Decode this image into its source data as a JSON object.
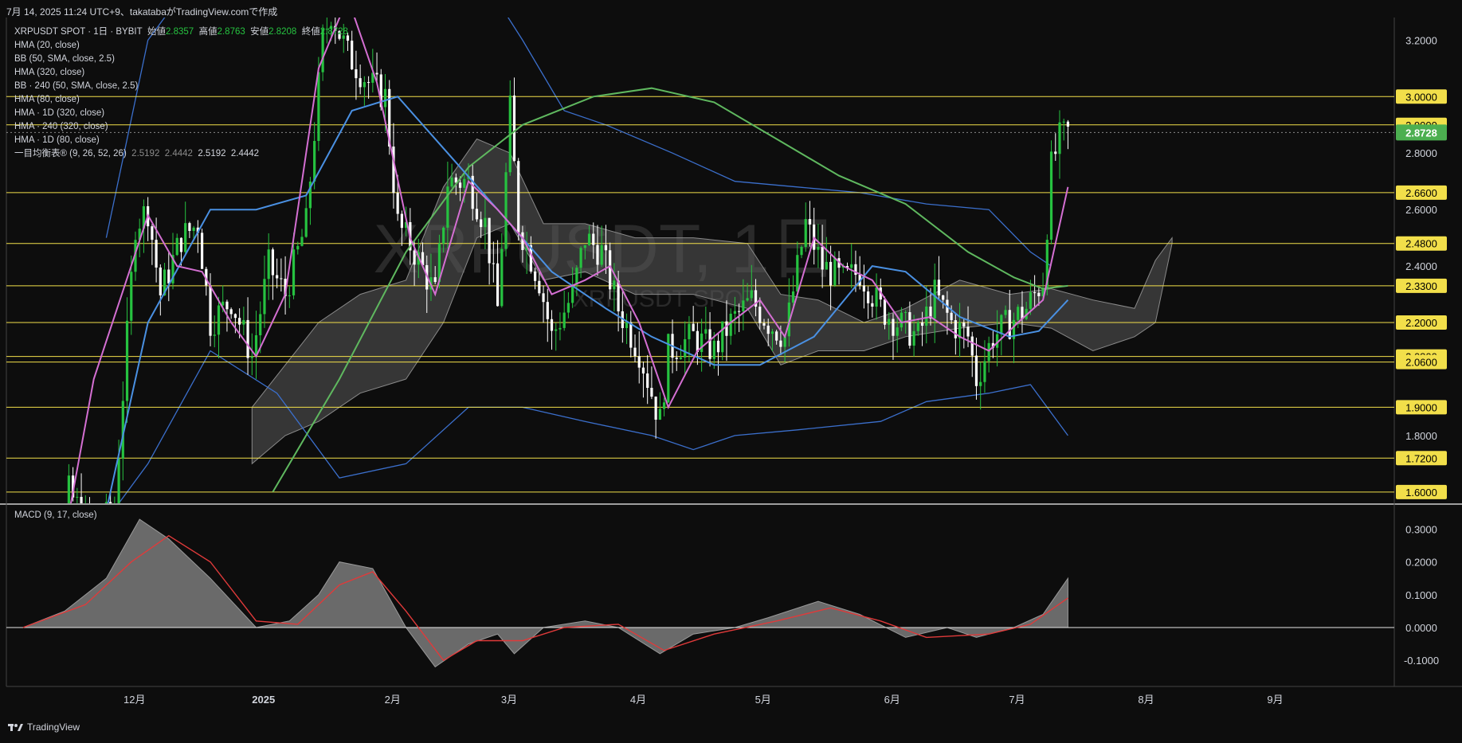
{
  "header": {
    "snapshot_line": "7月 14, 2025 11:24 UTC+9、takatabaがTradingView.comで作成"
  },
  "legend": {
    "symbol": "XRPUSDT SPOT · 1日 · BYBIT",
    "open_label": "始値",
    "open": "2.8357",
    "high_label": "高値",
    "high": "2.8763",
    "low_label": "安値",
    "low": "2.8208",
    "close_label": "終値",
    "close": "2.8728",
    "indicators": [
      "HMA (20, close)",
      "BB (50, SMA, close, 2.5)",
      "HMA (320, close)",
      "BB · 240 (50, SMA, close, 2.5)",
      "HMA (80, close)",
      "HMA · 1D (320, close)",
      "HMA · 240 (320, close)",
      "HMA · 1D (80, close)"
    ],
    "ichimoku": "一目均衡表® (9, 26, 52, 26)",
    "ichimoku_values": [
      "2.5192",
      "2.4442",
      "2.5192",
      "2.4442"
    ]
  },
  "watermark": {
    "main": "XRPUSDT, 1日",
    "sub": "XRPUSDT SPOT"
  },
  "macd_title": "MACD (9, 17, close)",
  "footer": {
    "brand": "TradingView"
  },
  "colors": {
    "background": "#0d0d0d",
    "up": "#26c240",
    "down": "#ffffff",
    "hma20": "#d46fd2",
    "hma80": "#4a90e2",
    "hma320": "#5fb85f",
    "bb": "#3b6fcc",
    "cloud": "#5a5a5a",
    "level": "#f2df4a",
    "last_price": "#4caf50",
    "macd_signal": "#e03a3a"
  },
  "chart_data": [
    {
      "type": "candlestick",
      "title": "XRPUSDT, 1日",
      "x_axis_labels": [
        "12月",
        "2025",
        "2月",
        "3月",
        "4月",
        "5月",
        "6月",
        "7月",
        "8月",
        "9月"
      ],
      "y_axis_ticks": [
        "3.2000",
        "2.8000",
        "2.6000",
        "2.4000",
        "1.8000"
      ],
      "ylim": [
        1.56,
        3.28
      ],
      "date_range": [
        "2024-11-01",
        "2025-09-30"
      ],
      "last_price": "2.8728",
      "horizontal_levels": [
        "3.0000",
        "2.9000",
        "2.6600",
        "2.4800",
        "2.3300",
        "2.2000",
        "2.0800",
        "2.0600",
        "1.9000",
        "1.7200",
        "1.6000"
      ],
      "close_path": [
        [
          "2024-11-05",
          0.55
        ],
        [
          "2024-11-12",
          1.1
        ],
        [
          "2024-11-16",
          1.6
        ],
        [
          "2024-11-22",
          1.45
        ],
        [
          "2024-11-27",
          1.55
        ],
        [
          "2024-12-02",
          2.55
        ],
        [
          "2024-12-05",
          2.6
        ],
        [
          "2024-12-08",
          2.3
        ],
        [
          "2024-12-13",
          2.5
        ],
        [
          "2024-12-17",
          2.55
        ],
        [
          "2024-12-20",
          2.2
        ],
        [
          "2024-12-25",
          2.28
        ],
        [
          "2024-12-30",
          2.08
        ],
        [
          "2025-01-03",
          2.4
        ],
        [
          "2025-01-07",
          2.3
        ],
        [
          "2025-01-12",
          2.55
        ],
        [
          "2025-01-16",
          3.2
        ],
        [
          "2025-01-18",
          3.3
        ],
        [
          "2025-01-22",
          3.15
        ],
        [
          "2025-01-27",
          3.05
        ],
        [
          "2025-01-31",
          3.0
        ],
        [
          "2025-02-03",
          2.55
        ],
        [
          "2025-02-07",
          2.45
        ],
        [
          "2025-02-12",
          2.3
        ],
        [
          "2025-02-15",
          2.7
        ],
        [
          "2025-02-20",
          2.7
        ],
        [
          "2025-02-24",
          2.55
        ],
        [
          "2025-02-27",
          2.25
        ],
        [
          "2025-03-02",
          2.95
        ],
        [
          "2025-03-04",
          2.55
        ],
        [
          "2025-03-09",
          2.35
        ],
        [
          "2025-03-12",
          2.15
        ],
        [
          "2025-03-17",
          2.3
        ],
        [
          "2025-03-20",
          2.5
        ],
        [
          "2025-03-24",
          2.45
        ],
        [
          "2025-03-28",
          2.25
        ],
        [
          "2025-04-02",
          2.1
        ],
        [
          "2025-04-07",
          1.85
        ],
        [
          "2025-04-09",
          2.1
        ],
        [
          "2025-04-15",
          2.15
        ],
        [
          "2025-04-20",
          2.1
        ],
        [
          "2025-04-24",
          2.2
        ],
        [
          "2025-04-29",
          2.28
        ],
        [
          "2025-05-03",
          2.2
        ],
        [
          "2025-05-07",
          2.15
        ],
        [
          "2025-05-12",
          2.55
        ],
        [
          "2025-05-16",
          2.4
        ],
        [
          "2025-05-21",
          2.35
        ],
        [
          "2025-05-25",
          2.38
        ],
        [
          "2025-05-30",
          2.25
        ],
        [
          "2025-06-03",
          2.2
        ],
        [
          "2025-06-08",
          2.15
        ],
        [
          "2025-06-12",
          2.3
        ],
        [
          "2025-06-16",
          2.2
        ],
        [
          "2025-06-20",
          2.15
        ],
        [
          "2025-06-22",
          2.0
        ],
        [
          "2025-06-26",
          2.15
        ],
        [
          "2025-06-30",
          2.2
        ],
        [
          "2025-07-04",
          2.25
        ],
        [
          "2025-07-08",
          2.35
        ],
        [
          "2025-07-10",
          2.75
        ],
        [
          "2025-07-12",
          2.85
        ],
        [
          "2025-07-14",
          2.8728
        ]
      ],
      "hma20": [
        [
          "2024-11-12",
          1.2
        ],
        [
          "2024-11-22",
          2.0
        ],
        [
          "2024-12-05",
          2.58
        ],
        [
          "2024-12-12",
          2.4
        ],
        [
          "2024-12-18",
          2.38
        ],
        [
          "2024-12-25",
          2.2
        ],
        [
          "2024-12-31",
          2.08
        ],
        [
          "2025-01-07",
          2.3
        ],
        [
          "2025-01-15",
          3.1
        ],
        [
          "2025-01-22",
          3.35
        ],
        [
          "2025-01-29",
          3.05
        ],
        [
          "2025-02-06",
          2.5
        ],
        [
          "2025-02-12",
          2.3
        ],
        [
          "2025-02-20",
          2.7
        ],
        [
          "2025-02-27",
          2.6
        ],
        [
          "2025-03-05",
          2.5
        ],
        [
          "2025-03-12",
          2.3
        ],
        [
          "2025-03-20",
          2.35
        ],
        [
          "2025-03-26",
          2.4
        ],
        [
          "2025-04-02",
          2.2
        ],
        [
          "2025-04-09",
          1.9
        ],
        [
          "2025-04-16",
          2.1
        ],
        [
          "2025-04-24",
          2.2
        ],
        [
          "2025-05-01",
          2.28
        ],
        [
          "2025-05-07",
          2.15
        ],
        [
          "2025-05-14",
          2.5
        ],
        [
          "2025-05-21",
          2.4
        ],
        [
          "2025-05-28",
          2.35
        ],
        [
          "2025-06-04",
          2.2
        ],
        [
          "2025-06-11",
          2.22
        ],
        [
          "2025-06-18",
          2.15
        ],
        [
          "2025-06-25",
          2.1
        ],
        [
          "2025-07-02",
          2.2
        ],
        [
          "2025-07-08",
          2.28
        ],
        [
          "2025-07-14",
          2.68
        ]
      ],
      "hma80": [
        [
          "2024-11-20",
          1.2
        ],
        [
          "2024-12-05",
          2.2
        ],
        [
          "2024-12-20",
          2.6
        ],
        [
          "2024-12-31",
          2.6
        ],
        [
          "2025-01-12",
          2.65
        ],
        [
          "2025-01-23",
          2.95
        ],
        [
          "2025-02-03",
          3.0
        ],
        [
          "2025-02-15",
          2.8
        ],
        [
          "2025-02-27",
          2.6
        ],
        [
          "2025-03-12",
          2.38
        ],
        [
          "2025-03-25",
          2.25
        ],
        [
          "2025-04-05",
          2.15
        ],
        [
          "2025-04-20",
          2.05
        ],
        [
          "2025-05-01",
          2.05
        ],
        [
          "2025-05-14",
          2.15
        ],
        [
          "2025-05-28",
          2.4
        ],
        [
          "2025-06-05",
          2.38
        ],
        [
          "2025-06-18",
          2.22
        ],
        [
          "2025-06-30",
          2.15
        ],
        [
          "2025-07-07",
          2.17
        ],
        [
          "2025-07-14",
          2.28
        ]
      ],
      "hma320": [
        [
          "2025-01-04",
          1.6
        ],
        [
          "2025-01-20",
          2.0
        ],
        [
          "2025-02-05",
          2.45
        ],
        [
          "2025-02-20",
          2.75
        ],
        [
          "2025-03-05",
          2.9
        ],
        [
          "2025-03-22",
          3.0
        ],
        [
          "2025-04-05",
          3.03
        ],
        [
          "2025-04-20",
          2.98
        ],
        [
          "2025-05-05",
          2.85
        ],
        [
          "2025-05-20",
          2.72
        ],
        [
          "2025-06-05",
          2.62
        ],
        [
          "2025-06-20",
          2.45
        ],
        [
          "2025-07-01",
          2.36
        ],
        [
          "2025-07-08",
          2.32
        ],
        [
          "2025-07-14",
          2.33
        ]
      ],
      "bb_upper": [
        [
          "2024-11-25",
          2.5
        ],
        [
          "2024-12-05",
          3.2
        ],
        [
          "2024-12-15",
          3.4
        ],
        [
          "2025-02-01",
          3.6
        ],
        [
          "2025-02-20",
          3.5
        ],
        [
          "2025-03-05",
          3.2
        ],
        [
          "2025-03-15",
          2.95
        ],
        [
          "2025-03-25",
          2.9
        ],
        [
          "2025-04-10",
          2.8
        ],
        [
          "2025-04-25",
          2.7
        ],
        [
          "2025-05-10",
          2.68
        ],
        [
          "2025-05-25",
          2.66
        ],
        [
          "2025-06-10",
          2.62
        ],
        [
          "2025-06-25",
          2.6
        ],
        [
          "2025-07-05",
          2.45
        ],
        [
          "2025-07-10",
          2.4
        ]
      ],
      "bb_lower": [
        [
          "2024-11-15",
          1.3
        ],
        [
          "2024-12-05",
          1.7
        ],
        [
          "2024-12-20",
          2.1
        ],
        [
          "2025-01-05",
          1.95
        ],
        [
          "2025-01-20",
          1.65
        ],
        [
          "2025-02-05",
          1.7
        ],
        [
          "2025-02-20",
          1.9
        ],
        [
          "2025-03-05",
          1.9
        ],
        [
          "2025-03-20",
          1.85
        ],
        [
          "2025-04-05",
          1.8
        ],
        [
          "2025-04-15",
          1.75
        ],
        [
          "2025-04-25",
          1.8
        ],
        [
          "2025-05-10",
          1.82
        ],
        [
          "2025-05-30",
          1.85
        ],
        [
          "2025-06-10",
          1.92
        ],
        [
          "2025-06-25",
          1.95
        ],
        [
          "2025-07-05",
          1.98
        ],
        [
          "2025-07-14",
          1.8
        ]
      ],
      "cloud": [
        [
          "2024-12-30",
          1.9,
          1.7
        ],
        [
          "2025-01-07",
          2.05,
          1.8
        ],
        [
          "2025-01-15",
          2.2,
          1.85
        ],
        [
          "2025-01-25",
          2.3,
          1.95
        ],
        [
          "2025-02-05",
          2.35,
          2.0
        ],
        [
          "2025-02-14",
          2.68,
          2.2
        ],
        [
          "2025-02-22",
          2.85,
          2.5
        ],
        [
          "2025-03-02",
          2.8,
          2.55
        ],
        [
          "2025-03-10",
          2.55,
          2.35
        ],
        [
          "2025-03-20",
          2.55,
          2.38
        ],
        [
          "2025-04-01",
          2.5,
          2.3
        ],
        [
          "2025-04-15",
          2.5,
          2.3
        ],
        [
          "2025-04-28",
          2.48,
          2.25
        ],
        [
          "2025-05-06",
          2.3,
          2.05
        ],
        [
          "2025-05-15",
          2.28,
          2.1
        ],
        [
          "2025-05-26",
          2.2,
          2.1
        ],
        [
          "2025-06-05",
          2.25,
          2.15
        ],
        [
          "2025-06-18",
          2.35,
          2.18
        ],
        [
          "2025-06-30",
          2.3,
          2.2
        ],
        [
          "2025-07-10",
          2.32,
          2.18
        ],
        [
          "2025-07-20",
          2.28,
          2.1
        ],
        [
          "2025-07-30",
          2.25,
          2.15
        ],
        [
          "2025-08-04",
          2.42,
          2.2
        ],
        [
          "2025-08-08",
          2.5,
          2.48
        ]
      ]
    },
    {
      "type": "area",
      "title": "MACD (9, 17, close)",
      "y_axis_ticks": [
        "0.3000",
        "0.2000",
        "0.1000",
        "0.0000",
        "-0.1000"
      ],
      "ylim": [
        -0.17,
        0.34
      ],
      "series": [
        {
          "name": "MACD",
          "points": [
            [
              "2024-11-05",
              0.0
            ],
            [
              "2024-11-15",
              0.05
            ],
            [
              "2024-11-25",
              0.15
            ],
            [
              "2024-12-03",
              0.33
            ],
            [
              "2024-12-10",
              0.27
            ],
            [
              "2024-12-20",
              0.15
            ],
            [
              "2024-12-31",
              0.0
            ],
            [
              "2025-01-08",
              0.02
            ],
            [
              "2025-01-15",
              0.1
            ],
            [
              "2025-01-20",
              0.2
            ],
            [
              "2025-01-28",
              0.18
            ],
            [
              "2025-02-05",
              0.0
            ],
            [
              "2025-02-12",
              -0.12
            ],
            [
              "2025-02-20",
              -0.05
            ],
            [
              "2025-02-27",
              -0.02
            ],
            [
              "2025-03-03",
              -0.08
            ],
            [
              "2025-03-10",
              0.0
            ],
            [
              "2025-03-20",
              0.02
            ],
            [
              "2025-03-28",
              0.0
            ],
            [
              "2025-04-07",
              -0.08
            ],
            [
              "2025-04-15",
              -0.02
            ],
            [
              "2025-04-25",
              0.0
            ],
            [
              "2025-05-03",
              0.03
            ],
            [
              "2025-05-15",
              0.08
            ],
            [
              "2025-05-25",
              0.04
            ],
            [
              "2025-06-05",
              -0.03
            ],
            [
              "2025-06-15",
              0.0
            ],
            [
              "2025-06-22",
              -0.03
            ],
            [
              "2025-07-01",
              0.0
            ],
            [
              "2025-07-08",
              0.04
            ],
            [
              "2025-07-14",
              0.15
            ]
          ]
        },
        {
          "name": "Signal",
          "points": [
            [
              "2024-11-05",
              0.0
            ],
            [
              "2024-11-20",
              0.07
            ],
            [
              "2024-12-01",
              0.2
            ],
            [
              "2024-12-10",
              0.28
            ],
            [
              "2024-12-20",
              0.2
            ],
            [
              "2024-12-31",
              0.02
            ],
            [
              "2025-01-10",
              0.01
            ],
            [
              "2025-01-20",
              0.13
            ],
            [
              "2025-01-28",
              0.17
            ],
            [
              "2025-02-05",
              0.05
            ],
            [
              "2025-02-14",
              -0.1
            ],
            [
              "2025-02-22",
              -0.04
            ],
            [
              "2025-03-05",
              -0.04
            ],
            [
              "2025-03-15",
              0.0
            ],
            [
              "2025-03-28",
              0.01
            ],
            [
              "2025-04-08",
              -0.07
            ],
            [
              "2025-04-20",
              -0.02
            ],
            [
              "2025-05-05",
              0.02
            ],
            [
              "2025-05-18",
              0.06
            ],
            [
              "2025-05-30",
              0.02
            ],
            [
              "2025-06-10",
              -0.03
            ],
            [
              "2025-06-25",
              -0.02
            ],
            [
              "2025-07-05",
              0.01
            ],
            [
              "2025-07-14",
              0.09
            ]
          ]
        }
      ]
    }
  ]
}
